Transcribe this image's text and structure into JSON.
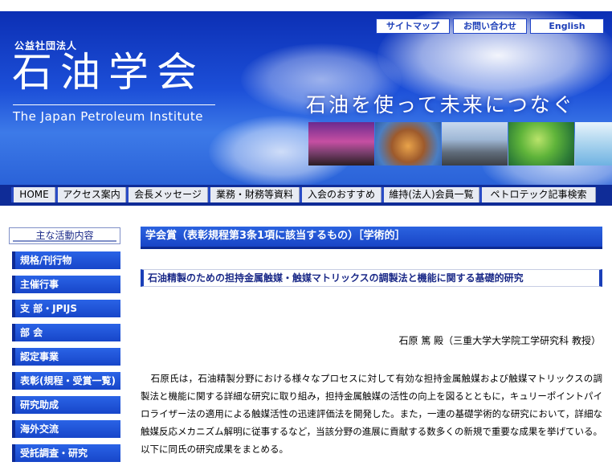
{
  "header": {
    "top_links": [
      "サイトマップ",
      "お問い合わせ",
      "English"
    ],
    "org_type": "公益社団法人",
    "org_name": "石油学会",
    "org_name_en": "The Japan Petroleum Institute",
    "slogan": "石油を使って未来につなぐ"
  },
  "nav": {
    "items": [
      "HOME",
      "アクセス案内",
      "会長メッセージ",
      "業務・財務等資料",
      "入会のおすすめ",
      "維持(法人)会員一覧",
      "ペトロテック記事検索"
    ]
  },
  "sidebar": {
    "title": "主な活動内容",
    "items": [
      "規格/刊行物",
      "主催行事",
      "支 部・JPIJS",
      "部 会",
      "認定事業",
      "表彰(規程・受賞一覧)",
      "研究助成",
      "海外交流",
      "受託調査・研究"
    ]
  },
  "main": {
    "section_title": "学会賞（表彰規程第3条1項に該当するもの）［学術的］",
    "award_title": "石油精製のための担持金属触媒・触媒マトリックスの調製法と機能に関する基礎的研究",
    "recipient": "石原 篤 殿（三重大学大学院工学研究科 教授）",
    "body": "石原氏は，石油精製分野における様々なプロセスに対して有効な担持金属触媒および触媒マトリックスの調製法と機能に関する詳細な研究に取り組み，担持金属触媒の活性の向上を図るとともに，キュリーポイントパイロライザー法の適用による触媒活性の迅速評価法を開発した。また，一連の基礎学術的な研究において，詳細な触媒反応メカニズム解明に従事するなど，当該分野の進展に貢献する数多くの新規で重要な成果を挙げている。以下に同氏の研究成果をまとめる。"
  }
}
